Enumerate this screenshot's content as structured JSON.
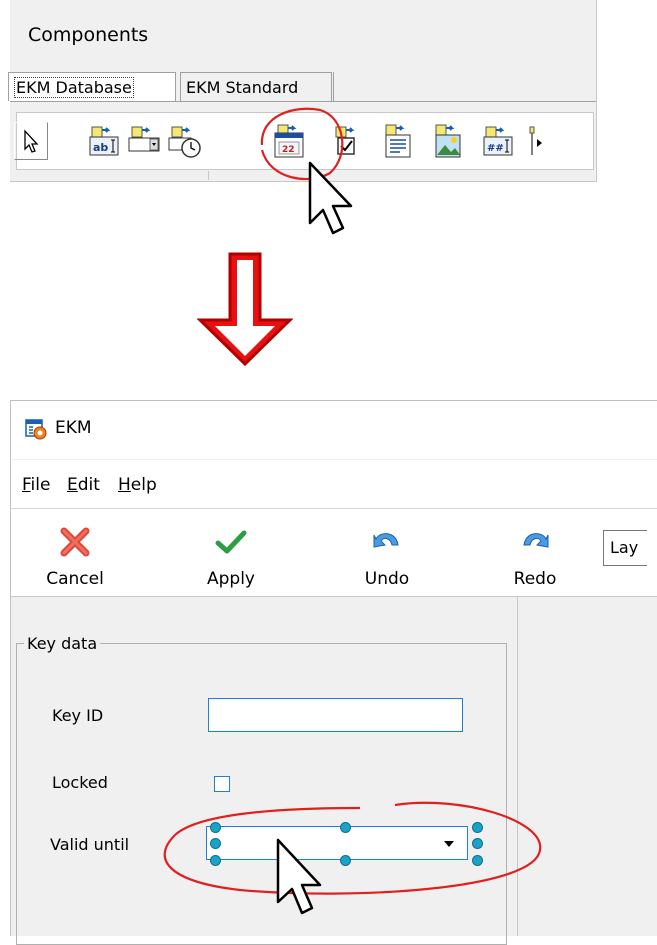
{
  "palette": {
    "title": "Components",
    "tabs": [
      {
        "label": "EKM Database",
        "active": true
      },
      {
        "label": "EKM Standard",
        "active": false
      }
    ],
    "tools": [
      {
        "icon": "pointer-icon"
      },
      {
        "icon": "db-edit-icon",
        "glyph": "ab"
      },
      {
        "icon": "db-combo-icon"
      },
      {
        "icon": "db-time-icon"
      },
      {
        "icon": "db-date-icon",
        "glyph": "22",
        "highlighted": true
      },
      {
        "icon": "db-checkbox-icon"
      },
      {
        "icon": "db-memo-icon"
      },
      {
        "icon": "db-image-icon"
      },
      {
        "icon": "db-mask-edit-icon",
        "glyph": "##"
      },
      {
        "icon": "scroll-right-icon"
      }
    ]
  },
  "window": {
    "title": "EKM",
    "menu": [
      {
        "label": "File",
        "accel": "F",
        "rest": "ile"
      },
      {
        "label": "Edit",
        "accel": "E",
        "rest": "dit"
      },
      {
        "label": "Help",
        "accel": "H",
        "rest": "elp"
      }
    ],
    "toolbar": [
      {
        "label": "Cancel",
        "icon": "cancel-x-icon"
      },
      {
        "label": "Apply",
        "icon": "checkmark-icon"
      },
      {
        "label": "Undo",
        "icon": "undo-icon"
      },
      {
        "label": "Redo",
        "icon": "redo-icon"
      }
    ],
    "layout_combo": "Lay",
    "group": {
      "title": "Key data",
      "fields": [
        {
          "label": "Key ID",
          "value": ""
        },
        {
          "label": "Locked",
          "checked": false
        },
        {
          "label": "Valid until",
          "value": ""
        }
      ]
    }
  },
  "colors": {
    "annotation_red": "#e02020",
    "focus_blue": "#1e7fd6",
    "handle_teal": "#1aa3c8"
  }
}
